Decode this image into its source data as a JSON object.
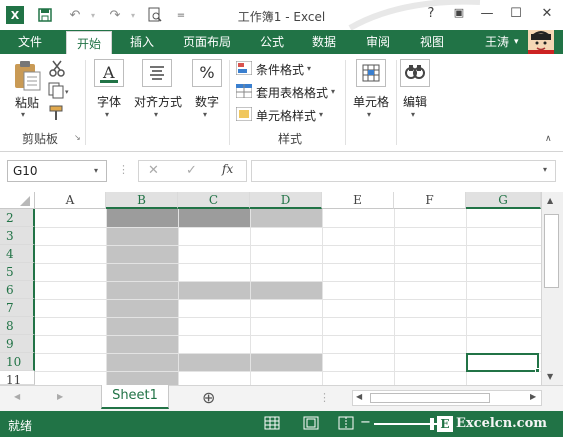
{
  "window": {
    "title": "工作簿1 - Excel",
    "help": "?",
    "restore_ribbon": "▣",
    "minimize": "—",
    "maximize": "☐",
    "close": "✕"
  },
  "qat": {
    "app_logo": "X",
    "save": "💾",
    "undo": "↶",
    "redo": "↷",
    "preview": "🔍",
    "more": "⫶"
  },
  "tabs": [
    "文件",
    "开始",
    "插入",
    "页面布局",
    "公式",
    "数据",
    "审阅",
    "视图"
  ],
  "user": {
    "name": "王涛",
    "caret": "▾"
  },
  "ribbon": {
    "clipboard": {
      "paste": "粘贴",
      "group": "剪贴板"
    },
    "font": {
      "label": "字体"
    },
    "align": {
      "label": "对齐方式"
    },
    "number": {
      "label": "数字",
      "icon": "%"
    },
    "styles": {
      "cond": "条件格式",
      "table": "套用表格格式",
      "cell": "单元格样式",
      "group": "样式"
    },
    "cells": {
      "label": "单元格"
    },
    "edit": {
      "label": "编辑"
    }
  },
  "formula_bar": {
    "name_box": "G10",
    "cancel": "✕",
    "enter": "✓",
    "fx": "fx",
    "value": ""
  },
  "grid": {
    "columns": [
      "A",
      "B",
      "C",
      "D",
      "E",
      "F",
      "G"
    ],
    "rows": [
      "2",
      "3",
      "4",
      "5",
      "6",
      "7",
      "8",
      "9",
      "10",
      "11"
    ],
    "selected_cell": "G10"
  },
  "sheets": {
    "tabs": [
      "Sheet1"
    ],
    "add": "⊕",
    "prev": "◀",
    "next": "▶"
  },
  "status": {
    "text": "就绪",
    "watermark": "Excelcn.com"
  }
}
